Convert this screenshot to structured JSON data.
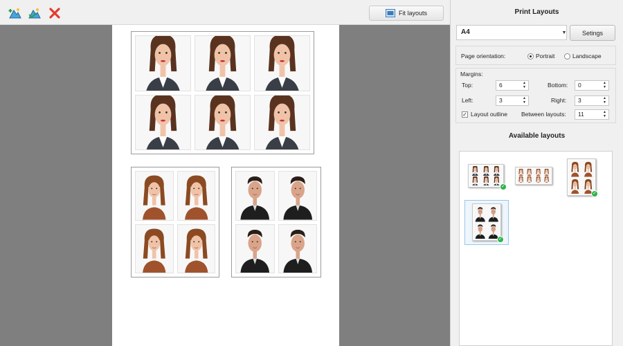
{
  "toolbar": {
    "fit_layouts_label": "Fit layouts",
    "icons": [
      "add-image-icon",
      "replace-image-icon",
      "delete-icon",
      "fit-layouts-icon"
    ]
  },
  "panel": {
    "title": "Print Layouts",
    "paper_size": "A4",
    "settings_label": "Setings",
    "orientation": {
      "label": "Page orientation:",
      "portrait_label": "Portrait",
      "landscape_label": "Landscape",
      "selected": "Portrait"
    },
    "margins": {
      "label": "Margins:",
      "top_label": "Top:",
      "top_value": "6",
      "bottom_label": "Bottom:",
      "bottom_value": "0",
      "left_label": "Left:",
      "left_value": "3",
      "right_label": "Right:",
      "right_value": "3",
      "outline_label": "Layout outline",
      "outline_checked": true,
      "between_label": "Between layouts:",
      "between_value": "11"
    },
    "available_title": "Available layouts"
  },
  "preview": {
    "sheets": [
      {
        "name": "woman-dark-6",
        "rows": 2,
        "cols": 3,
        "person": "woman-dark"
      },
      {
        "name": "woman-light-4",
        "rows": 2,
        "cols": 2,
        "person": "woman-light"
      },
      {
        "name": "man-4",
        "rows": 2,
        "cols": 2,
        "person": "man"
      }
    ]
  },
  "colors": {
    "canvas": "#7f7f7f",
    "badge": "#2fb34a",
    "selected_thumb": "#99c6e6"
  }
}
